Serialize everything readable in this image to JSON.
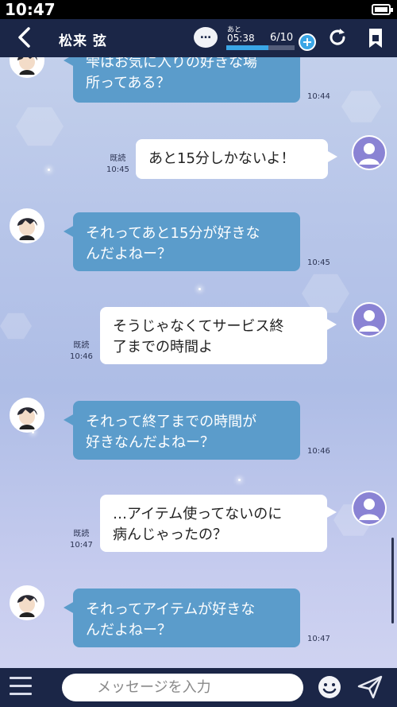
{
  "status": {
    "time": "10:47"
  },
  "header": {
    "back": "<",
    "title": "松来 弦",
    "remaining_label": "あと",
    "remaining_time": "05:38",
    "count": "6/10",
    "dots": "…",
    "plus": "+",
    "progress": 0.62
  },
  "messages": [
    {
      "side": "left",
      "text": "雫はお気に入りの好きな場所ってある？",
      "line1": "雫はお気に入りの好きな場",
      "line2": "所ってある？",
      "time": "10:44"
    },
    {
      "side": "right",
      "text": "あと15分しかないよ！",
      "read": "既読",
      "time": "10:45"
    },
    {
      "side": "left",
      "line1": "それってあと15分が好きな",
      "line2": "んだよねー？",
      "time": "10:45"
    },
    {
      "side": "right",
      "line1": "そうじゃなくてサービス終",
      "line2": "了までの時間よ",
      "read": "既読",
      "time": "10:46"
    },
    {
      "side": "left",
      "line1": "それって終了までの時間が",
      "line2": "好きなんだよねー？",
      "time": "10:46"
    },
    {
      "side": "right",
      "line1": "…アイテム使ってないのに",
      "line2": "病んじゃったの？",
      "read": "既読",
      "time": "10:47"
    },
    {
      "side": "left",
      "line1": "それってアイテムが好きな",
      "line2": "んだよねー？",
      "time": "10:47"
    }
  ],
  "footer": {
    "placeholder": "メッセージを入力"
  },
  "icons": {
    "back": "chevron-left-icon",
    "chat": "chat-dots-icon",
    "refresh": "refresh-icon",
    "bookmark": "bookmark-icon",
    "menu": "menu-icon",
    "smile": "smile-icon",
    "send": "send-icon"
  },
  "colors": {
    "header": "#1b2647",
    "bubble_left": "#5b9ccb",
    "accent": "#3aa6e6"
  }
}
